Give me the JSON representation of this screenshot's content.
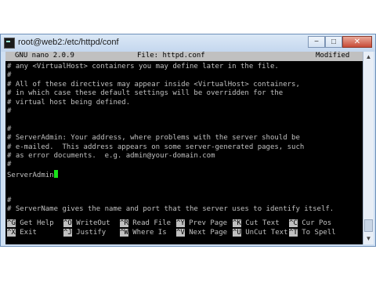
{
  "window": {
    "title": "root@web2:/etc/httpd/conf",
    "minimize_symbol": "−",
    "maximize_symbol": "□",
    "close_symbol": "✕"
  },
  "nano": {
    "version": "GNU nano 2.0.9",
    "file": "File: httpd.conf",
    "status": "Modified"
  },
  "lines": [
    "# any <VirtualHost> containers you may define later in the file.",
    "#",
    "# All of these directives may appear inside <VirtualHost> containers,",
    "# in which case these default settings will be overridden for the",
    "# virtual host being defined.",
    "#",
    "",
    "#",
    "# ServerAdmin: Your address, where problems with the server should be",
    "# e-mailed.  This address appears on some server-generated pages, such",
    "# as error documents.  e.g. admin@your-domain.com",
    "#",
    "ServerAdmin",
    "",
    "",
    "#",
    "# ServerName gives the name and port that the server uses to identify itself."
  ],
  "shortcuts": {
    "row1": [
      {
        "key": "^G",
        "label": "Get Help"
      },
      {
        "key": "^O",
        "label": "WriteOut"
      },
      {
        "key": "^R",
        "label": "Read File"
      },
      {
        "key": "^Y",
        "label": "Prev Page"
      },
      {
        "key": "^K",
        "label": "Cut Text"
      },
      {
        "key": "^C",
        "label": "Cur Pos"
      }
    ],
    "row2": [
      {
        "key": "^X",
        "label": "Exit"
      },
      {
        "key": "^J",
        "label": "Justify"
      },
      {
        "key": "^W",
        "label": "Where Is"
      },
      {
        "key": "^V",
        "label": "Next Page"
      },
      {
        "key": "^U",
        "label": "UnCut Text"
      },
      {
        "key": "^T",
        "label": "To Spell"
      }
    ]
  },
  "scrollbar": {
    "up": "▲",
    "down": "▼"
  },
  "colors": {
    "terminal_bg": "#000000",
    "terminal_fg": "#c0c0c0",
    "cursor": "#19e319",
    "header_bg": "#c0c0c0"
  }
}
